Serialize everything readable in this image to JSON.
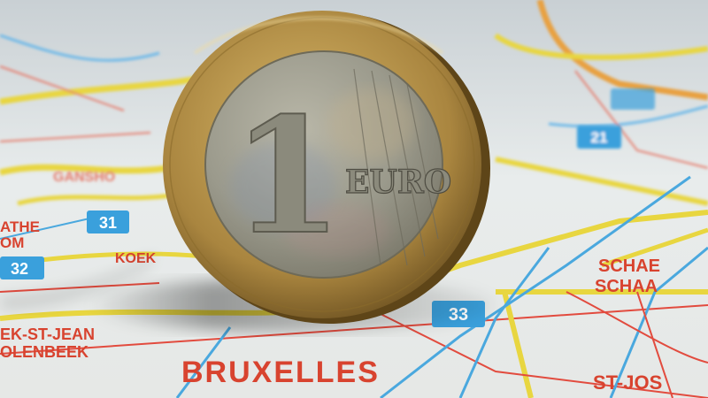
{
  "scene": {
    "description_colors": {
      "map_paper": "#e3e7e8",
      "road_yellow": "#e8d640",
      "road_red": "#e24b3e",
      "road_blue": "#4aa8de",
      "label_red": "#d8432f",
      "coin_gold": "#b8924a",
      "coin_silver": "#9a9a90"
    },
    "coin": {
      "numeral": "1",
      "word": "EURO"
    },
    "map_labels": {
      "bruxelles": "BRUXELLES",
      "molenbeek_1": "EK-ST-JEAN",
      "molenbeek_2": "OLENBEEK",
      "schaer_1": "SCHAE",
      "schaer_2": "SCHAA",
      "st_jos": "ST-JOS",
      "athe_1": "ATHE",
      "athe_2": "OM",
      "koek": "KOEK",
      "ganshoren": "GANSHO"
    },
    "route_badges": [
      "31",
      "32",
      "33",
      "21"
    ]
  }
}
